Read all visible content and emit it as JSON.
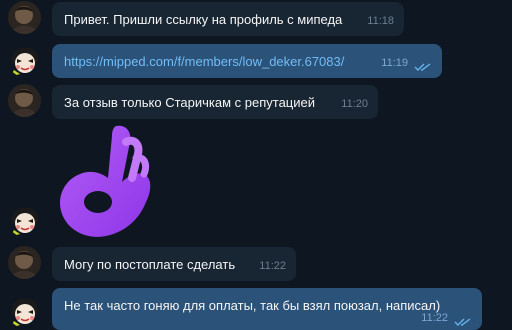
{
  "messages": [
    {
      "text": "Привет. Пришли ссылку на профиль с мипеда",
      "time": "11:18",
      "direction": "incoming"
    },
    {
      "text": "https://mipped.com/f/members/low_deker.67083/",
      "time": "11:19",
      "direction": "outgoing",
      "status": "read"
    },
    {
      "text": "За отзыв только Старичкам с репутацией",
      "time": "11:20",
      "direction": "incoming"
    },
    {
      "sticker": "ok-hand-sticker",
      "direction": "outgoing"
    },
    {
      "text": "Могу по постоплате сделать",
      "time": "11:22",
      "direction": "incoming"
    },
    {
      "text": "Не так часто гоняю для оплаты, так бы взял поюзал, написал)",
      "time": "11:22",
      "direction": "outgoing",
      "status": "read"
    }
  ],
  "colors": {
    "background": "#0e1621",
    "incoming_bubble": "#182533",
    "outgoing_bubble": "#2b5278",
    "link": "#72bcf8",
    "read_ticks": "#64b5ef",
    "sticker": "#a34cf0"
  },
  "icons": {
    "read_status": "double-check-icon",
    "partner_avatar": "dark-avatar",
    "own_avatar": "cartoon-avatar"
  }
}
